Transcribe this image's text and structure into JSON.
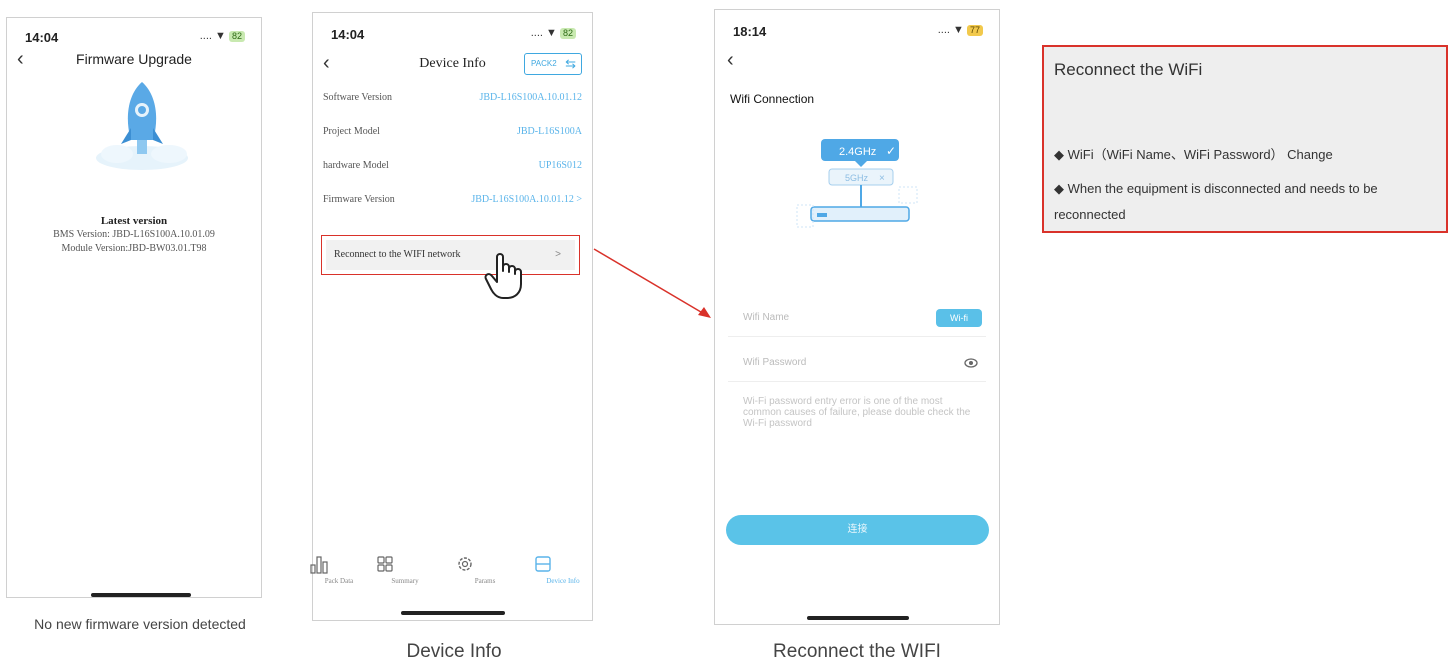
{
  "phone1": {
    "time": "14:04",
    "signal": "....",
    "battery": "82",
    "title": "Firmware Upgrade",
    "latest_heading": "Latest version",
    "bms_version": "BMS Version: JBD-L16S100A.10.01.09",
    "module_version": "Module Version:JBD-BW03.01.T98",
    "caption": "No new firmware version detected"
  },
  "phone2": {
    "time": "14:04",
    "signal": "....",
    "battery": "82",
    "title": "Device Info",
    "pack_button": "PACK2",
    "rows": [
      {
        "label": "Software Version",
        "value": "JBD-L16S100A.10.01.12"
      },
      {
        "label": "Project Model",
        "value": "JBD-L16S100A"
      },
      {
        "label": "hardware Model",
        "value": "UP16S012"
      },
      {
        "label": "Firmware Version",
        "value": "JBD-L16S100A.10.01.12 >"
      }
    ],
    "reconnect_label": "Reconnect to the WIFI network",
    "reconnect_chevron": ">",
    "tabs": [
      "Pack Data",
      "Summary",
      "Params",
      "Device Info"
    ],
    "caption": "Device Info",
    "accent": "#5ab4ea"
  },
  "phone3": {
    "time": "18:14",
    "signal": "....",
    "battery": "77",
    "title": "Wifi Connection",
    "band_primary": "2.4GHz",
    "band_secondary": "5GHz",
    "wifi_name_placeholder": "Wifi Name",
    "wifi_button": "Wi-fi",
    "wifi_password_placeholder": "Wifi Password",
    "note": "Wi-Fi password entry error is one of the most common causes of failure, please double check the Wi-Fi password",
    "connect_label": "连接",
    "caption": "Reconnect the WIFI",
    "accent": "#5ac3e8"
  },
  "note_box": {
    "heading": "Reconnect the WiFi",
    "items": [
      "◆ WiFi（WiFi Name、WiFi Password） Change",
      "◆ When the equipment is disconnected and needs to be reconnected"
    ],
    "border_color": "#d9322a"
  }
}
